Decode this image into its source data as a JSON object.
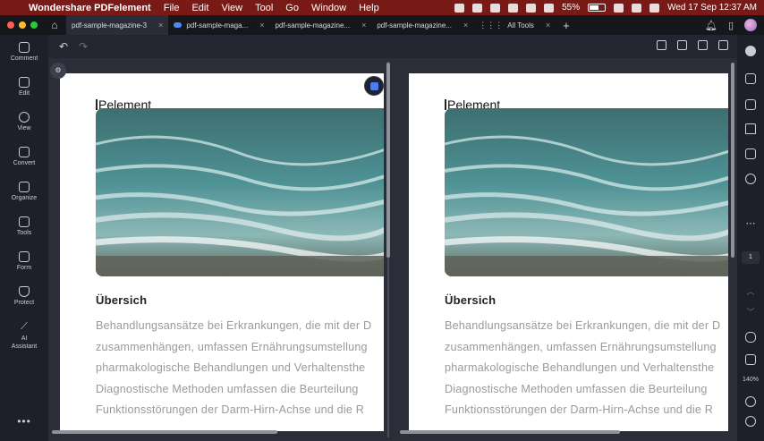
{
  "menubar": {
    "app_name": "Wondershare PDFelement",
    "items": [
      "File",
      "Edit",
      "View",
      "Tool",
      "Go",
      "Window",
      "Help"
    ],
    "battery": "55%",
    "datetime": "Wed 17 Sep  12:37 AM"
  },
  "tabs": [
    {
      "label": "pdf-sample-magazine-3"
    },
    {
      "label": "pdf-sample-maga..."
    },
    {
      "label": "pdf-sample-magazine..."
    },
    {
      "label": "pdf-sample-magazine..."
    },
    {
      "label": "All Tools"
    }
  ],
  "leftbar": {
    "items": [
      "Comment",
      "Edit",
      "View",
      "Convert",
      "Organize",
      "Tools",
      "Form",
      "Protect",
      "AI Assistant"
    ],
    "more": "•••"
  },
  "document": {
    "brand": "Pelement",
    "heading": "Übersich",
    "paragraph_lines": [
      "Behandlungsansätze bei Erkrankungen, die mit der D",
      "zusammenhängen, umfassen Ernährungsumstellung",
      "pharmakologische Behandlungen und Verhaltensthe",
      "Diagnostische Methoden umfassen die Beurteilung",
      "Funktionsstörungen der Darm-Hirn-Achse und die R"
    ]
  },
  "rightbar": {
    "page_number": "1",
    "zoom": "140%"
  }
}
